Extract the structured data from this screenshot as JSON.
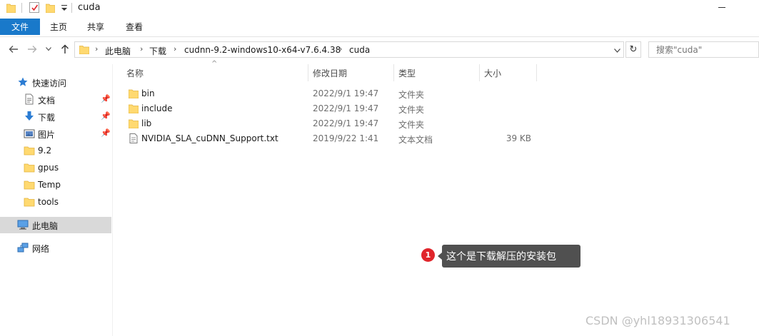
{
  "window": {
    "title": "cuda"
  },
  "ribbon": {
    "tabs": [
      "文件",
      "主页",
      "共享",
      "查看"
    ]
  },
  "address": {
    "crumbs": [
      "此电脑",
      "下载",
      "cudnn-9.2-windows10-x64-v7.6.4.38",
      "cuda"
    ],
    "search_placeholder": "搜索\"cuda\""
  },
  "sidebar": {
    "quick_access": "快速访问",
    "pinned": [
      "文档",
      "下载",
      "图片"
    ],
    "folders": [
      "9.2",
      "gpus",
      "Temp",
      "tools"
    ],
    "this_pc": "此电脑",
    "network": "网络"
  },
  "columns": {
    "name": "名称",
    "date": "修改日期",
    "type": "类型",
    "size": "大小"
  },
  "files": [
    {
      "name": "bin",
      "date": "2022/9/1 19:47",
      "type": "文件夹",
      "size": "",
      "icon": "folder-icon"
    },
    {
      "name": "include",
      "date": "2022/9/1 19:47",
      "type": "文件夹",
      "size": "",
      "icon": "folder-icon"
    },
    {
      "name": "lib",
      "date": "2022/9/1 19:47",
      "type": "文件夹",
      "size": "",
      "icon": "folder-icon"
    },
    {
      "name": "NVIDIA_SLA_cuDNN_Support.txt",
      "date": "2019/9/22 1:41",
      "type": "文本文档",
      "size": "39 KB",
      "icon": "text-file-icon"
    }
  ],
  "annotation": {
    "number": "1",
    "text": "这个是下载解压的安装包"
  },
  "watermark": "CSDN @yhl18931306541",
  "colors": {
    "accent": "#1979ca",
    "folder": "#ffd970",
    "badge": "#e0252b",
    "callout": "#505050"
  }
}
